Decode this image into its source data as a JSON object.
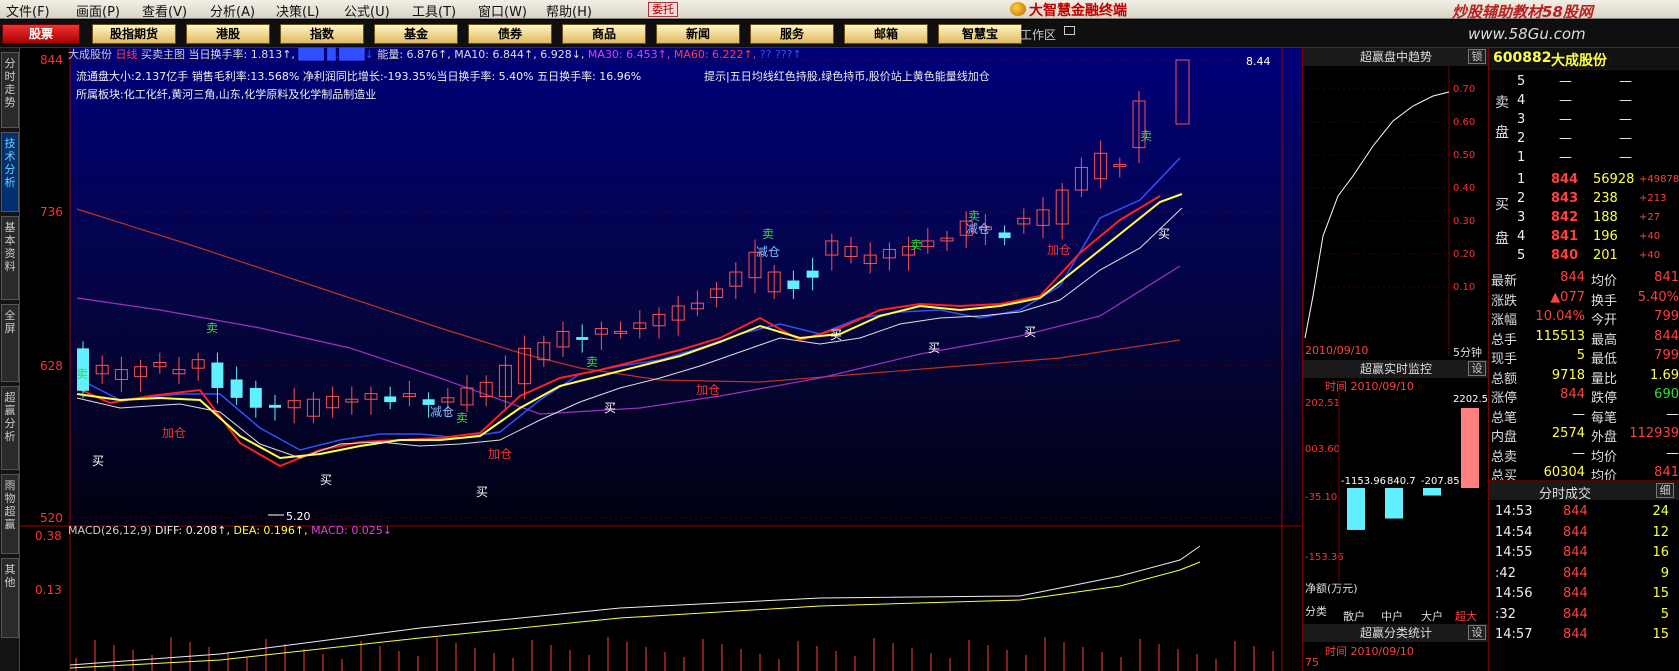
{
  "menu": {
    "items": [
      "文件(F)",
      "画面(P)",
      "查看(V)",
      "分析(A)",
      "决策(L)",
      "公式(U)",
      "工具(T)",
      "窗口(W)",
      "帮助(H)"
    ],
    "badge": "委托",
    "brand": "大智慧金融终端",
    "watermark": "炒股辅助教材58股网"
  },
  "toolbar": {
    "buttons": [
      "股票",
      "股指期货",
      "港股",
      "指数",
      "基金",
      "债券",
      "商品",
      "新闻",
      "服务",
      "邮箱",
      "智慧宝"
    ],
    "workspace": "工作区",
    "watermark_url": "www.58Gu.com"
  },
  "sidetabs": [
    "分时走势",
    "技术分析",
    "基本资料",
    "全屏",
    "超赢分析",
    "雨物超赢",
    "其他"
  ],
  "header": {
    "stock": "大成股份",
    "period": "日线",
    "mode": "买卖主图",
    "turnover": "当日换手率: 1.813↑,",
    "energy": "能量: 6.876↑,",
    "ma10": "MA10: 6.844↑,",
    "ma20": "6.928↓,",
    "ma30": "MA30: 6.453↑,",
    "ma60": "MA60: 6.222↑,",
    "ma_extra": "?? ???↑",
    "line2": "流通盘大小:2.137亿手   销售毛利率:13.568%   净利润同比增长:-193.35%当日换手率: 5.40%  五日换手率:  16.96%",
    "tip": "提示|五日均线红色持股,绿色持币,股价站上黄色能量线加仓",
    "line3": "所属板块:化工化纤,黄河三角,山东,化学原料及化学制品制造业",
    "price_tag": "8.44",
    "low_tag": "5.20"
  },
  "yaxis_main": [
    "844",
    "736",
    "628",
    "520"
  ],
  "yaxis_sub": [
    "0.38",
    "0.13"
  ],
  "macd_label": {
    "prefix": "MACD(26,12,9)",
    "diff": "DIFF: 0.208↑,",
    "dea": "DEA: 0.196↑,",
    "macd": "MACD: 0.025↓"
  },
  "signals": [
    {
      "text": "卖",
      "kind": "sell"
    },
    {
      "text": "加仓",
      "kind": "add"
    },
    {
      "text": "买",
      "kind": "buy"
    },
    {
      "text": "卖",
      "kind": "sell"
    },
    {
      "text": "买",
      "kind": "buy"
    },
    {
      "text": "减仓",
      "kind": "reduce"
    },
    {
      "text": "卖",
      "kind": "sell"
    },
    {
      "text": "加仓",
      "kind": "add"
    },
    {
      "text": "买",
      "kind": "buy"
    },
    {
      "text": "卖",
      "kind": "sell"
    },
    {
      "text": "买",
      "kind": "buy"
    },
    {
      "text": "加仓",
      "kind": "add"
    },
    {
      "text": "卖",
      "kind": "sell"
    },
    {
      "text": "减仓",
      "kind": "reduce"
    },
    {
      "text": "买",
      "kind": "buy"
    },
    {
      "text": "卖",
      "kind": "sell"
    },
    {
      "text": "卖",
      "kind": "sell"
    },
    {
      "text": "减仓",
      "kind": "reduce"
    },
    {
      "text": "买",
      "kind": "buy"
    },
    {
      "text": "买",
      "kind": "buy"
    },
    {
      "text": "加仓",
      "kind": "add"
    },
    {
      "text": "卖",
      "kind": "sell"
    },
    {
      "text": "买",
      "kind": "buy"
    }
  ],
  "panel_trend": {
    "title": "超赢盘中趋势",
    "btn": "锁",
    "date": "2010/09/10",
    "period": "5分钟",
    "yticks": [
      "0.70",
      "0.60",
      "0.50",
      "0.40",
      "0.30",
      "0.20",
      "0.10"
    ]
  },
  "panel_monitor": {
    "title": "超赢实时监控",
    "btn": "设",
    "time": "时间  2010/09/10",
    "yticks": [
      "202.51",
      "003.60",
      "-35.10",
      "-153.36"
    ],
    "top_value": "2202.51",
    "neg_labels": [
      "-1153.96",
      "840.7",
      "-207.85"
    ],
    "unit": "净额(万元)",
    "cats": [
      "分类",
      "散户",
      "中户",
      "大户",
      "超大"
    ],
    "bars": [
      -1153.96,
      -840.7,
      -207.85,
      2202.51
    ]
  },
  "panel_stats": {
    "title": "超赢分类统计",
    "btn": "设",
    "time": "时间  2010/09/10",
    "ytick": "75"
  },
  "quote": {
    "code": "600882",
    "name": "大成股份",
    "sell": [
      {
        "lvl": "5",
        "price": "—",
        "vol": "—"
      },
      {
        "lvl": "4",
        "price": "—",
        "vol": "—"
      },
      {
        "lvl": "3",
        "price": "—",
        "vol": "—"
      },
      {
        "lvl": "2",
        "price": "—",
        "vol": "—"
      },
      {
        "lvl": "1",
        "price": "—",
        "vol": "—"
      }
    ],
    "sell_label": [
      "卖",
      "盘"
    ],
    "buy_label": [
      "买",
      "盘"
    ],
    "buy": [
      {
        "lvl": "1",
        "price": "844",
        "vol": "56928",
        "chg": "+49878"
      },
      {
        "lvl": "2",
        "price": "843",
        "vol": "238",
        "chg": "+213"
      },
      {
        "lvl": "3",
        "price": "842",
        "vol": "188",
        "chg": "+27"
      },
      {
        "lvl": "4",
        "price": "841",
        "vol": "196",
        "chg": "+40"
      },
      {
        "lvl": "5",
        "price": "840",
        "vol": "201",
        "chg": "+40"
      }
    ],
    "stats": [
      {
        "l1": "最新",
        "v1": "844",
        "l2": "均价",
        "v2": "841"
      },
      {
        "l1": "涨跌",
        "v1": "▲077",
        "l2": "换手",
        "v2": "5.40%"
      },
      {
        "l1": "涨幅",
        "v1": "10.04%",
        "l2": "今开",
        "v2": "799"
      },
      {
        "l1": "总手",
        "v1": "115513",
        "l2": "最高",
        "v2": "844"
      },
      {
        "l1": "现手",
        "v1": "5",
        "l2": "最低",
        "v2": "799"
      },
      {
        "l1": "总额",
        "v1": "9718",
        "l2": "量比",
        "v2": "1.69"
      },
      {
        "l1": "涨停",
        "v1": "844",
        "l2": "跌停",
        "v2": "690"
      },
      {
        "l1": "总笔",
        "v1": "—",
        "l2": "每笔",
        "v2": "—"
      },
      {
        "l1": "内盘",
        "v1": "2574",
        "l2": "外盘",
        "v2": "112939"
      },
      {
        "l1": "总卖",
        "v1": "—",
        "l2": "均价",
        "v2": "—"
      },
      {
        "l1": "总买",
        "v1": "60304",
        "l2": "均价",
        "v2": "841"
      }
    ],
    "ticks_title": "分时成交",
    "ticks_btn": "细",
    "ticks": [
      {
        "t": "14:53",
        "p": "844",
        "v": "24"
      },
      {
        "t": "14:54",
        "p": "844",
        "v": "12"
      },
      {
        "t": "14:55",
        "p": "844",
        "v": "16"
      },
      {
        "t": ":42",
        "p": "844",
        "v": "9"
      },
      {
        "t": "14:56",
        "p": "844",
        "v": "15"
      },
      {
        "t": ":32",
        "p": "844",
        "v": "5"
      },
      {
        "t": "14:57",
        "p": "844",
        "v": "15"
      }
    ]
  }
}
